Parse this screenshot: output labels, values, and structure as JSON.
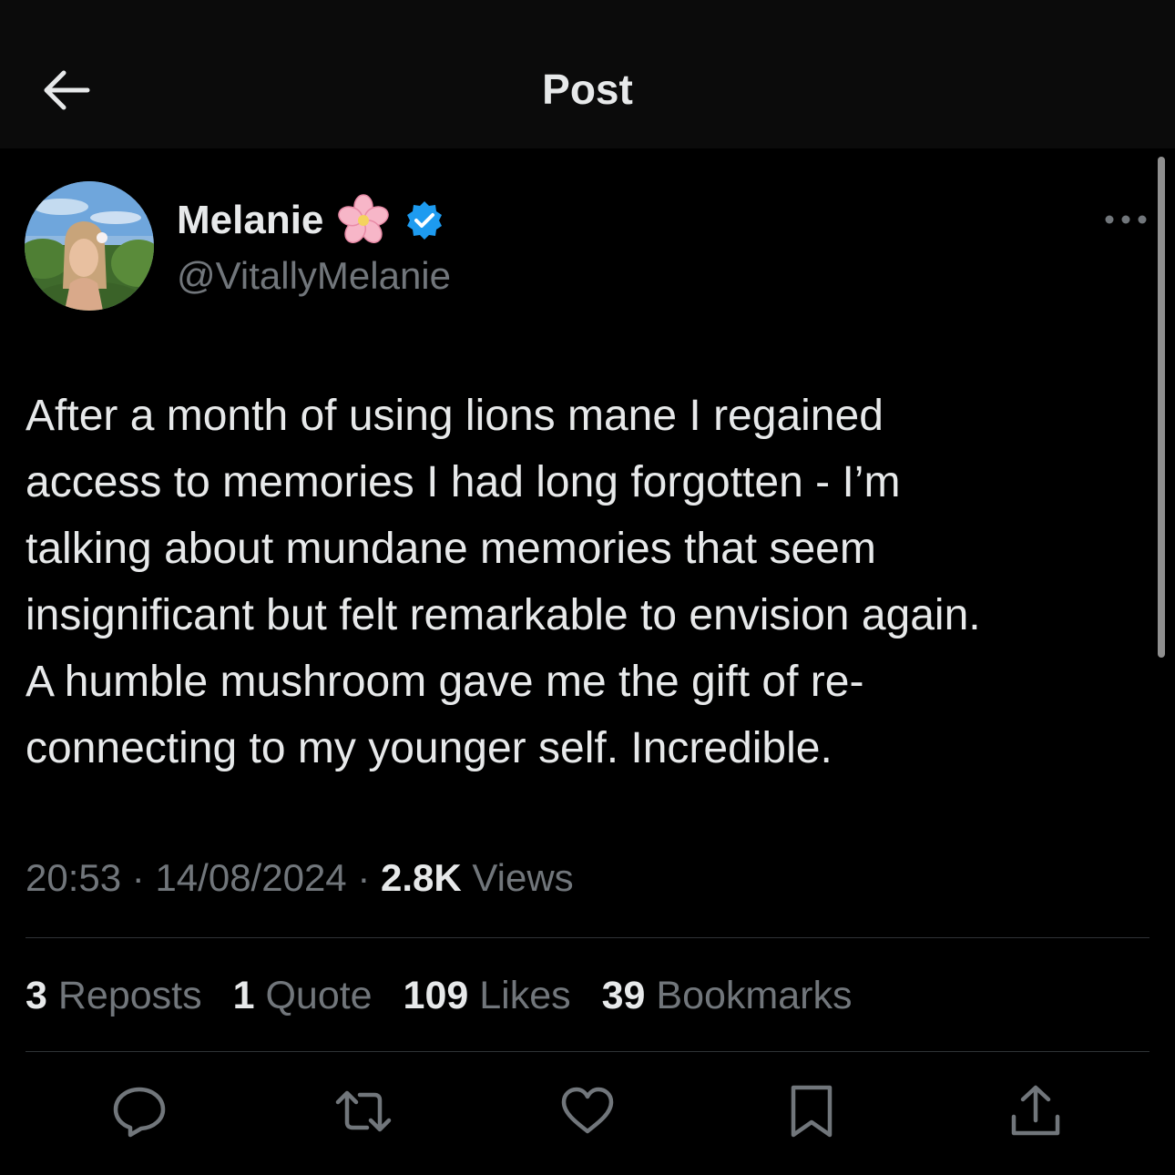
{
  "header": {
    "title": "Post",
    "back_icon": "arrow-left-icon"
  },
  "author": {
    "display_name": "Melanie",
    "emoji_icon": "cherry-blossom-icon",
    "verified_icon": "verified-badge-icon",
    "handle": "@VitallyMelanie"
  },
  "post": {
    "text": "After a month of using lions mane I regained\naccess to memories I had long forgotten - I’m\ntalking about mundane memories that seem\ninsignificant but felt remarkable to envision again.\nA humble mushroom gave me the gift of re-\nconnecting to my younger self. Incredible.",
    "time": "20:53",
    "separator": "·",
    "date": "14/08/2024",
    "views_count": "2.8K",
    "views_label": "Views"
  },
  "stats": {
    "reposts_count": "3",
    "reposts_label": "Reposts",
    "quotes_count": "1",
    "quotes_label": "Quote",
    "likes_count": "109",
    "likes_label": "Likes",
    "bookmarks_count": "39",
    "bookmarks_label": "Bookmarks"
  },
  "actions": [
    "reply-icon",
    "repost-icon",
    "like-icon",
    "bookmark-icon",
    "share-icon"
  ],
  "colors": {
    "background": "#000000",
    "header_background": "#0b0b0b",
    "primary_text": "#e7e9ea",
    "secondary_text": "#71767b",
    "divider": "#2f3336",
    "verified": "#1d9bf0"
  }
}
